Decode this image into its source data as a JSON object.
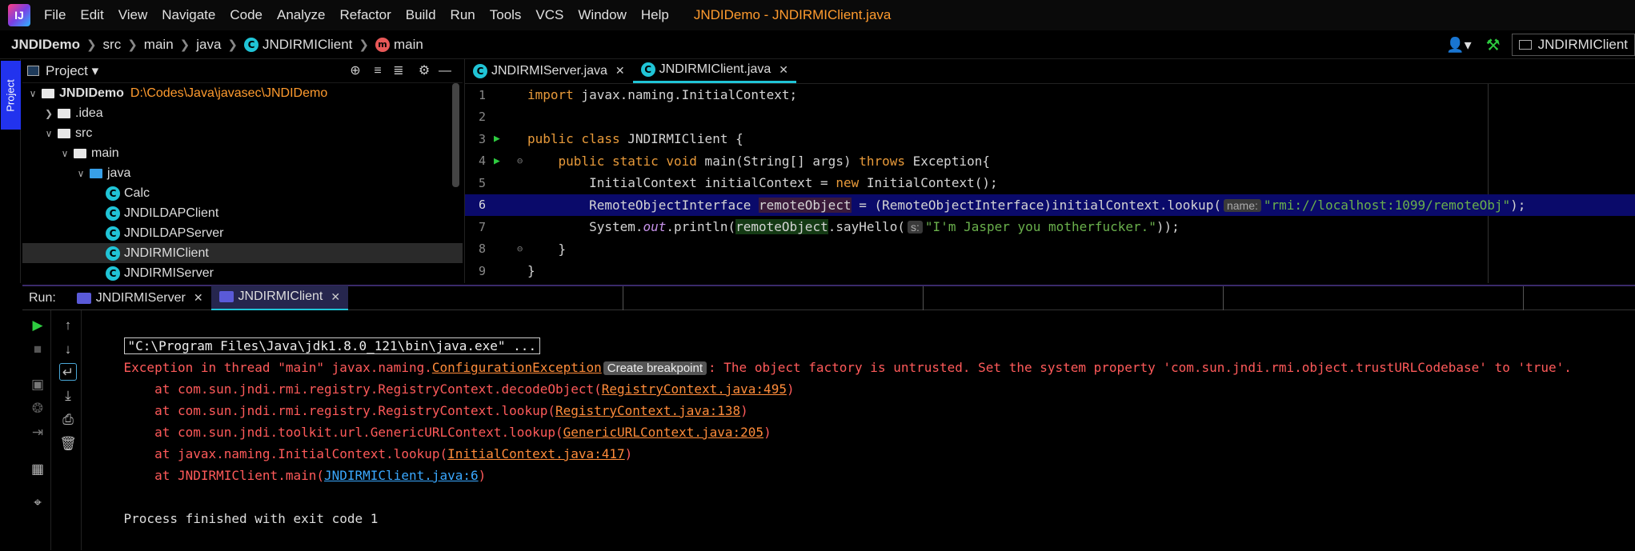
{
  "menubar": {
    "logo": "IJ",
    "items": [
      "File",
      "Edit",
      "View",
      "Navigate",
      "Code",
      "Analyze",
      "Refactor",
      "Build",
      "Run",
      "Tools",
      "VCS",
      "Window",
      "Help"
    ],
    "title": "JNDIDemo - JNDIRMIClient.java"
  },
  "navbar": {
    "crumbs": [
      "JNDIDemo",
      "src",
      "main",
      "java",
      "JNDIRMIClient",
      "main"
    ],
    "run_config": "JNDIRMIClient"
  },
  "project": {
    "tab_label": "Project",
    "title": "Project",
    "root": {
      "name": "JNDIDemo",
      "path": "D:\\Codes\\Java\\javasec\\JNDIDemo"
    },
    "items": [
      ".idea",
      "src",
      "main",
      "java",
      "Calc",
      "JNDILDAPClient",
      "JNDILDAPServer",
      "JNDIRMIClient",
      "JNDIRMIServer"
    ]
  },
  "editor": {
    "tabs": [
      "JNDIRMIServer.java",
      "JNDIRMIClient.java"
    ],
    "active_tab": 1,
    "lines": {
      "l1_kw": "import",
      "l1_rest": " javax.naming.InitialContext;",
      "l3_kw": "public class",
      "l3_rest": " JNDIRMIClient {",
      "l4_kw": "public static void",
      "l4_name": " main(String[] args) ",
      "l4_kw2": "throws",
      "l4_rest": " Exception{",
      "l5_a": "InitialContext initialContext = ",
      "l5_kw": "new",
      "l5_b": " InitialContext();",
      "l6_a": "RemoteObjectInterface ",
      "l6_var": "remoteObject",
      "l6_b": " = (RemoteObjectInterface)initialContext.lookup(",
      "l6_hint": "name:",
      "l6_str": "\"rmi://localhost:1099/remoteObj\"",
      "l6_c": ");",
      "l7_a": "System.",
      "l7_out": "out",
      "l7_b": ".println(",
      "l7_var": "remoteObject",
      "l7_c": ".sayHello(",
      "l7_hint": "s:",
      "l7_str": "\"I'm Jasper you motherfucker.\"",
      "l7_d": "));",
      "l8": "}",
      "l9": "}"
    }
  },
  "run": {
    "label": "Run:",
    "tabs": [
      "JNDIRMIServer",
      "JNDIRMIClient"
    ],
    "active_tab": 1
  },
  "console": {
    "cmd": "\"C:\\Program Files\\Java\\jdk1.8.0_121\\bin\\java.exe\" ...",
    "exc_prefix": "Exception in thread \"main\" javax.naming.",
    "exc_link": "ConfigurationException",
    "bp_chip": "Create breakpoint",
    "exc_msg": ": The object factory is untrusted. Set the system property 'com.sun.jndi.rmi.object.trustURLCodebase' to 'true'.",
    "stack": [
      {
        "pre": "    at com.sun.jndi.rmi.registry.RegistryContext.decodeObject(",
        "link": "RegistryContext.java:495",
        "post": ")"
      },
      {
        "pre": "    at com.sun.jndi.rmi.registry.RegistryContext.lookup(",
        "link": "RegistryContext.java:138",
        "post": ")"
      },
      {
        "pre": "    at com.sun.jndi.toolkit.url.GenericURLContext.lookup(",
        "link": "GenericURLContext.java:205",
        "post": ")"
      },
      {
        "pre": "    at javax.naming.InitialContext.lookup(",
        "link": "InitialContext.java:417",
        "post": ")"
      },
      {
        "pre": "    at JNDIRMIClient.main(",
        "link": "JNDIRMIClient.java:6",
        "post": ")"
      }
    ],
    "exit": "Process finished with exit code 1"
  }
}
